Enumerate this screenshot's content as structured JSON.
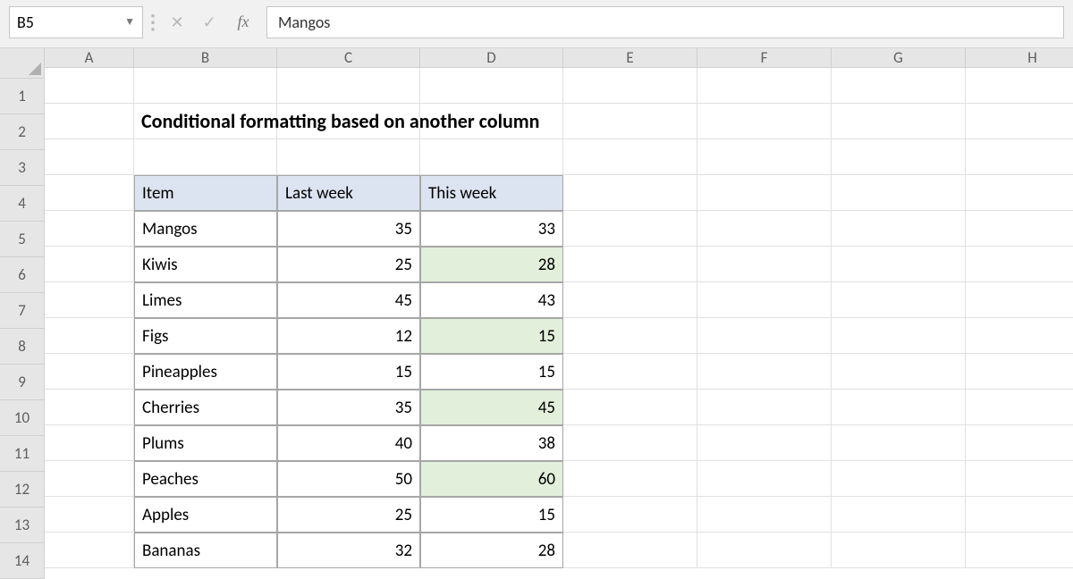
{
  "namebox": {
    "value": "B5"
  },
  "formula": {
    "value": "Mangos",
    "fx_label": "fx"
  },
  "columns": [
    "A",
    "B",
    "C",
    "D",
    "E",
    "F",
    "G",
    "H"
  ],
  "rows": [
    "1",
    "2",
    "3",
    "4",
    "5",
    "6",
    "7",
    "8",
    "9",
    "10",
    "11",
    "12",
    "13",
    "14"
  ],
  "title": "Conditional formatting based on another column",
  "table": {
    "headers": {
      "item": "Item",
      "last": "Last week",
      "this": "This week"
    },
    "rows": [
      {
        "item": "Mangos",
        "last": 35,
        "this": 33,
        "hl": false
      },
      {
        "item": "Kiwis",
        "last": 25,
        "this": 28,
        "hl": true
      },
      {
        "item": "Limes",
        "last": 45,
        "this": 43,
        "hl": false
      },
      {
        "item": "Figs",
        "last": 12,
        "this": 15,
        "hl": true
      },
      {
        "item": "Pineapples",
        "last": 15,
        "this": 15,
        "hl": false
      },
      {
        "item": "Cherries",
        "last": 35,
        "this": 45,
        "hl": true
      },
      {
        "item": "Plums",
        "last": 40,
        "this": 38,
        "hl": false
      },
      {
        "item": "Peaches",
        "last": 50,
        "this": 60,
        "hl": true
      },
      {
        "item": "Apples",
        "last": 25,
        "this": 15,
        "hl": false
      },
      {
        "item": "Bananas",
        "last": 32,
        "this": 28,
        "hl": false
      }
    ]
  },
  "colors": {
    "highlight": "#e2efda",
    "header_fill": "#dce4f2"
  }
}
